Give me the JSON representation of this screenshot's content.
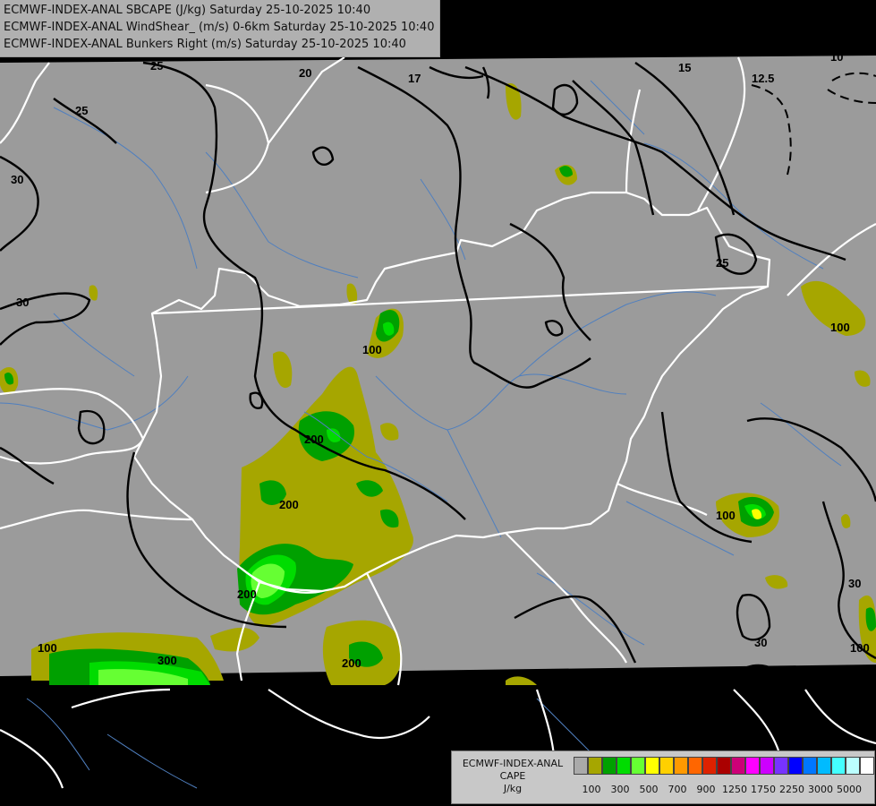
{
  "header": {
    "line1": "ECMWF-INDEX-ANAL SBCAPE (J/kg) Saturday 25-10-2025 10:40",
    "line2": "ECMWF-INDEX-ANAL WindShear_ (m/s) 0-6km Saturday 25-10-2025 10:40",
    "line3": "ECMWF-INDEX-ANAL Bunkers Right (m/s) Saturday 25-10-2025 10:40"
  },
  "legend": {
    "line1": "ECMWF-INDEX-ANAL",
    "line2": "CAPE",
    "line3": "J/kg",
    "swatch_colors": [
      "#aaaaaa",
      "#a6a600",
      "#00a000",
      "#00dc00",
      "#66ff33",
      "#ffff00",
      "#ffd000",
      "#ff9900",
      "#ff6600",
      "#dd2200",
      "#aa0000",
      "#cc0077",
      "#ff00ff",
      "#cc00ff",
      "#7733ff",
      "#0000ff",
      "#0077ff",
      "#00bbff",
      "#44ffff",
      "#bbffff",
      "#ffffff"
    ],
    "ticks": [
      "100",
      "300",
      "500",
      "700",
      "900",
      "1250",
      "1750",
      "2250",
      "3000",
      "5000"
    ]
  },
  "map_colors": {
    "background": "#000000",
    "land": "#9b9b9b",
    "cape_100": "#a6a600",
    "cape_200": "#00a000",
    "cape_300": "#00dc00",
    "cape_500": "#66ff33",
    "border": "#ffffff",
    "river": "#4f7fbf",
    "contour": "#000000"
  },
  "contour_labels": [
    "25",
    "20",
    "17",
    "15",
    "12.5",
    "10",
    "30",
    "25",
    "30",
    "25",
    "100",
    "200",
    "200",
    "200",
    "100",
    "300",
    "200",
    "100",
    "100",
    "30",
    "30",
    "100"
  ]
}
